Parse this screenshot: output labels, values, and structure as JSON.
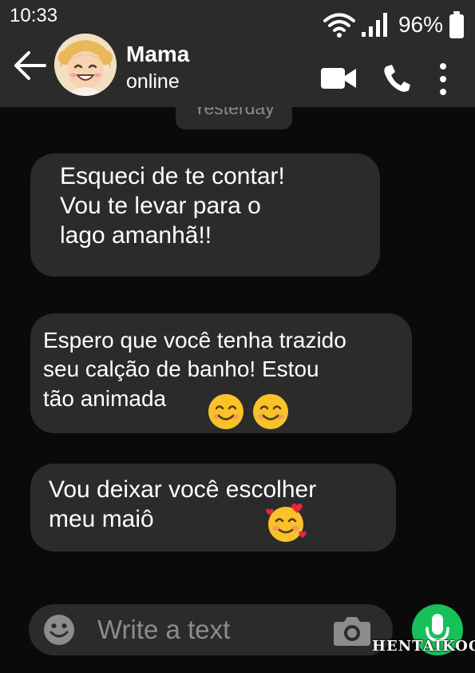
{
  "status_bar": {
    "time": "10:33",
    "battery": "96%",
    "icons": [
      "wifi-icon",
      "signal-icon",
      "battery-icon"
    ]
  },
  "header": {
    "contact_name": "Mama",
    "contact_status": "online",
    "icons": [
      "back-arrow-icon",
      "avatar",
      "video-call-icon",
      "phone-call-icon",
      "more-options-icon"
    ]
  },
  "conversation": {
    "date_chip": "Yesterday",
    "messages": [
      {
        "text": "Esqueci de te contar!\nVou te levar para o\nlago amanhã!!",
        "emoji": []
      },
      {
        "text": "Espero que você tenha trazido\nseu calção de banho! Estou\ntão animada",
        "emoji": [
          "smiling-face-emoji",
          "smiling-face-emoji"
        ]
      },
      {
        "text": "Vou deixar você escolher\nmeu maiô",
        "emoji": [
          "smiling-face-with-hearts-emoji"
        ]
      }
    ]
  },
  "composer": {
    "placeholder": "Write a text",
    "icons": [
      "emoji-icon",
      "camera-icon",
      "microphone-icon"
    ]
  },
  "watermark": "HENTAIKOGA",
  "colors": {
    "background": "#0a0a0a",
    "bar": "#2b2b2b",
    "bubble": "#2b2b2b",
    "text": "#ffffff",
    "muted": "#8c8c8c",
    "mic_button": "#17c15a"
  }
}
